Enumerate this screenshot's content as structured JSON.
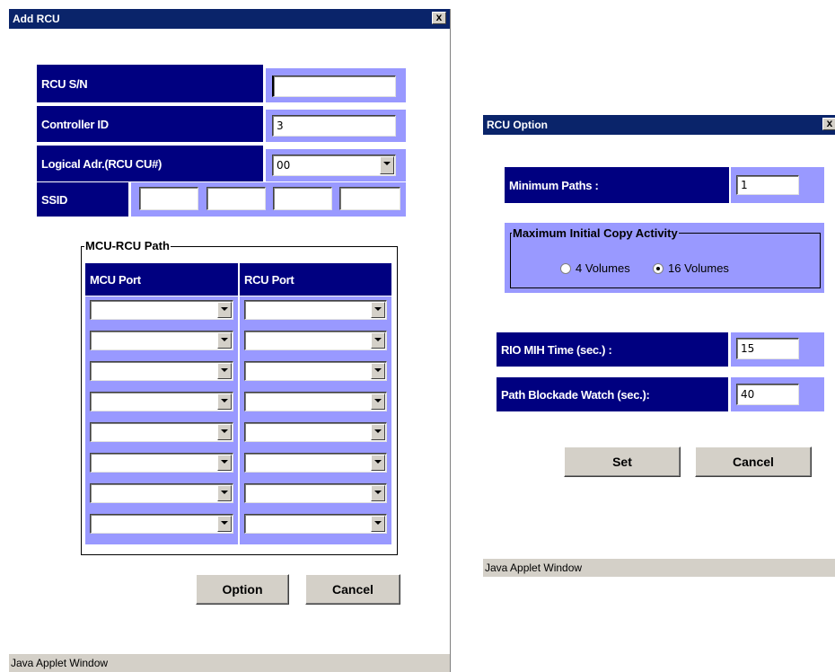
{
  "add_rcu": {
    "title": "Add RCU",
    "close": "x",
    "rcu_sn_label": "RCU S/N",
    "rcu_sn_value": "",
    "controller_id_label": "Controller ID",
    "controller_id_value": "3",
    "logical_adr_label": "Logical Adr.(RCU CU#)",
    "logical_adr_value": "00",
    "ssid_label": "SSID",
    "ssid_values": [
      "",
      "",
      "",
      ""
    ],
    "path_group_title": "MCU-RCU Path",
    "mcu_port_header": "MCU Port",
    "rcu_port_header": "RCU Port",
    "path_rows": [
      {
        "mcu": "",
        "rcu": ""
      },
      {
        "mcu": "",
        "rcu": ""
      },
      {
        "mcu": "",
        "rcu": ""
      },
      {
        "mcu": "",
        "rcu": ""
      },
      {
        "mcu": "",
        "rcu": ""
      },
      {
        "mcu": "",
        "rcu": ""
      },
      {
        "mcu": "",
        "rcu": ""
      },
      {
        "mcu": "",
        "rcu": ""
      }
    ],
    "option_button": "Option",
    "cancel_button": "Cancel",
    "status": "Java Applet Window"
  },
  "rcu_option": {
    "title": "RCU Option",
    "close": "x",
    "min_paths_label": "Minimum Paths :",
    "min_paths_value": "1",
    "max_copy_group_title": "Maximum Initial Copy Activity",
    "radio_4_label": "4 Volumes",
    "radio_16_label": "16 Volumes",
    "radio_selected": "16 Volumes",
    "rio_mih_label": "RIO MIH Time (sec.) :",
    "rio_mih_value": "15",
    "path_blockade_label": "Path Blockade Watch (sec.):",
    "path_blockade_value": "40",
    "set_button": "Set",
    "cancel_button": "Cancel",
    "status": "Java Applet Window"
  },
  "colors": {
    "title_bar": "#0a246a",
    "label_bg": "#000080",
    "panel_lavender": "#9999ff",
    "button_face": "#d4d0c8"
  }
}
